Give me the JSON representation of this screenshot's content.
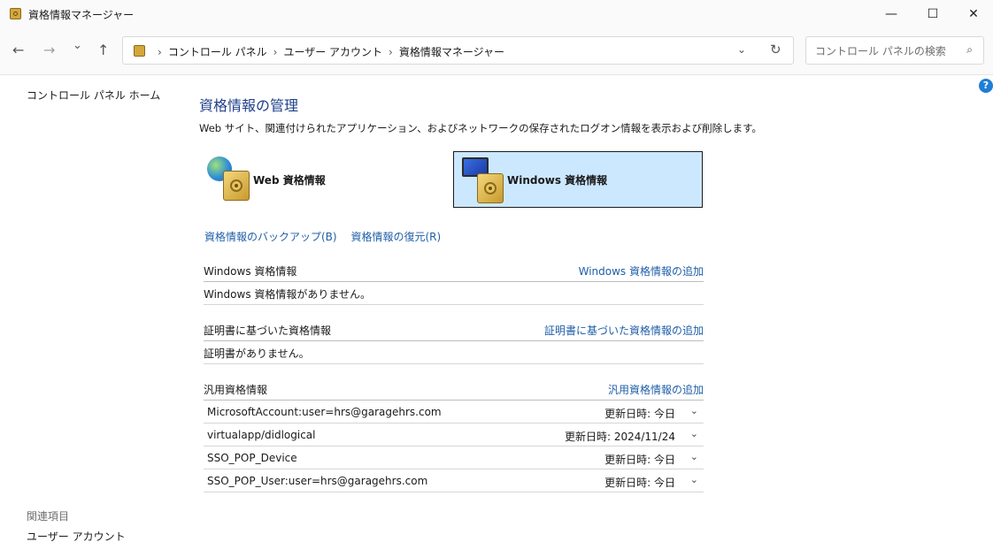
{
  "window": {
    "title": "資格情報マネージャー",
    "minimize_glyph": "—",
    "maximize_glyph": "☐",
    "close_glyph": "✕"
  },
  "nav": {
    "back_glyph": "←",
    "forward_glyph": "→",
    "recent_glyph": "⌄",
    "up_glyph": "↑"
  },
  "address": {
    "separator": "›",
    "crumbs": [
      "コントロール パネル",
      "ユーザー アカウント",
      "資格情報マネージャー"
    ],
    "dropdown_glyph": "⌄",
    "refresh_glyph": "↻"
  },
  "search": {
    "placeholder": "コントロール パネルの検索",
    "icon_glyph": "⌕"
  },
  "help_glyph": "?",
  "sidebar": {
    "home": "コントロール パネル ホーム",
    "related_heading": "関連項目",
    "related_items": [
      "ユーザー アカウント"
    ]
  },
  "main": {
    "heading": "資格情報の管理",
    "description": "Web サイト、関連付けられたアプリケーション、およびネットワークの保存されたログオン情報を表示および削除します。",
    "tiles": {
      "web": "Web 資格情報",
      "windows": "Windows 資格情報",
      "selected": "windows"
    },
    "backup_link": "資格情報のバックアップ(B)",
    "restore_link": "資格情報の復元(R)",
    "sections": {
      "windows": {
        "title": "Windows 資格情報",
        "add_link": "Windows 資格情報の追加",
        "empty_text": "Windows 資格情報がありません。"
      },
      "certificate": {
        "title": "証明書に基づいた資格情報",
        "add_link": "証明書に基づいた資格情報の追加",
        "empty_text": "証明書がありません。"
      },
      "generic": {
        "title": "汎用資格情報",
        "add_link": "汎用資格情報の追加",
        "items": [
          {
            "name": "MicrosoftAccount:user=hrs@garagehrs.com",
            "modified": "更新日時:  今日"
          },
          {
            "name": "virtualapp/didlogical",
            "modified": "更新日時:  2024/11/24"
          },
          {
            "name": "SSO_POP_Device",
            "modified": "更新日時:  今日"
          },
          {
            "name": "SSO_POP_User:user=hrs@garagehrs.com",
            "modified": "更新日時:  今日"
          }
        ]
      }
    }
  }
}
